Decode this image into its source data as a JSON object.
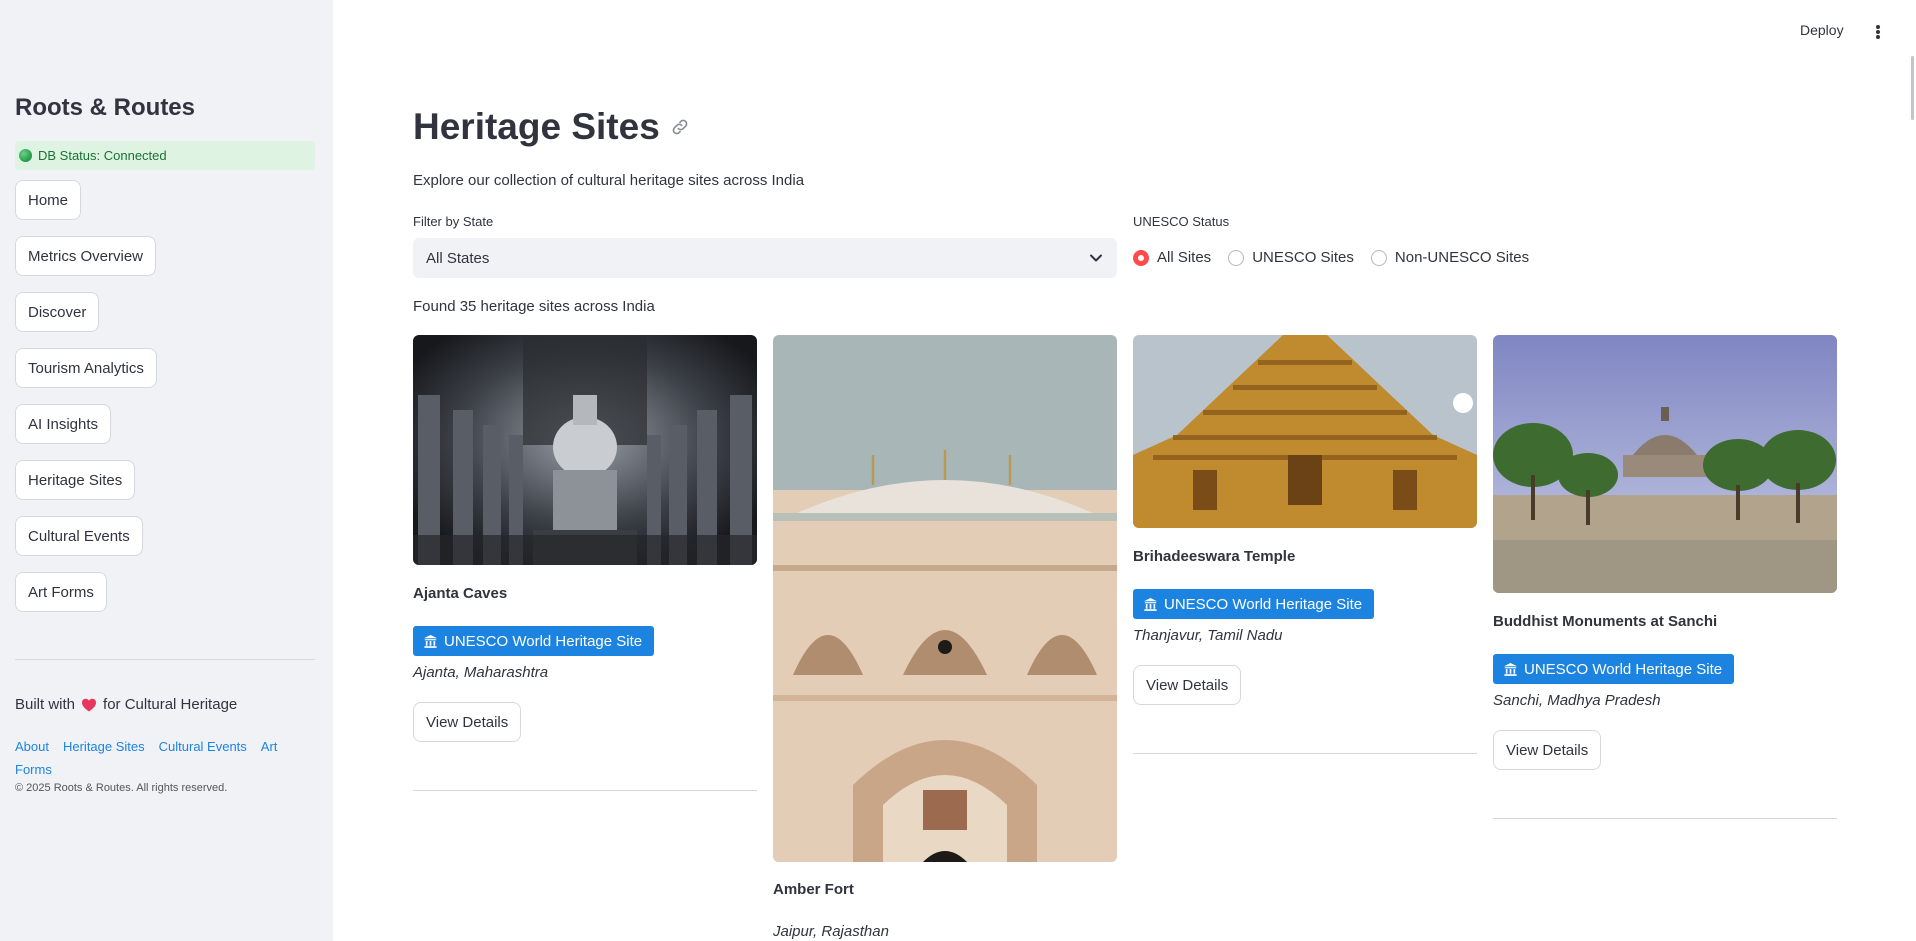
{
  "sidebar": {
    "brand": "Roots & Routes",
    "db_status": "DB Status: Connected",
    "nav": [
      "Home",
      "Metrics Overview",
      "Discover",
      "Tourism Analytics",
      "AI Insights",
      "Heritage Sites",
      "Cultural Events",
      "Art Forms"
    ],
    "built_with_prefix": "Built with",
    "built_with_suffix": "for Cultural Heritage",
    "footer_links": [
      "About",
      "Heritage Sites",
      "Cultural Events",
      "Art Forms"
    ],
    "copyright": "© 2025 Roots & Routes. All rights reserved."
  },
  "header": {
    "deploy": "Deploy"
  },
  "main": {
    "title": "Heritage Sites",
    "subtitle": "Explore our collection of cultural heritage sites across India",
    "filter_label": "Filter by State",
    "filter_value": "All States",
    "unesco_label": "UNESCO Status",
    "radio_options": [
      "All Sites",
      "UNESCO Sites",
      "Non-UNESCO Sites"
    ],
    "radio_selected": "All Sites",
    "found_text": "Found 35 heritage sites across India"
  },
  "sites": [
    {
      "name": "Ajanta Caves",
      "badge": "UNESCO World Heritage Site",
      "location": "Ajanta, Maharashtra",
      "button": "View Details"
    },
    {
      "name": "Amber Fort",
      "location": "Jaipur, Rajasthan"
    },
    {
      "name": "Brihadeeswara Temple",
      "badge": "UNESCO World Heritage Site",
      "location": "Thanjavur, Tamil Nadu",
      "button": "View Details"
    },
    {
      "name": "Buddhist Monuments at Sanchi",
      "badge": "UNESCO World Heritage Site",
      "location": "Sanchi, Madhya Pradesh",
      "button": "View Details"
    }
  ],
  "colors": {
    "accent": "#ff4b4b",
    "badge": "#1c83e1",
    "sidebar_bg": "#f0f2f6",
    "status_bg": "#dff3e3",
    "status_text": "#177233"
  },
  "icons": {
    "title_anchor": "link-icon",
    "badge": "classical-building-icon",
    "heart": "heart-icon",
    "menu": "kebab-menu-icon",
    "select": "chevron-down-icon"
  }
}
